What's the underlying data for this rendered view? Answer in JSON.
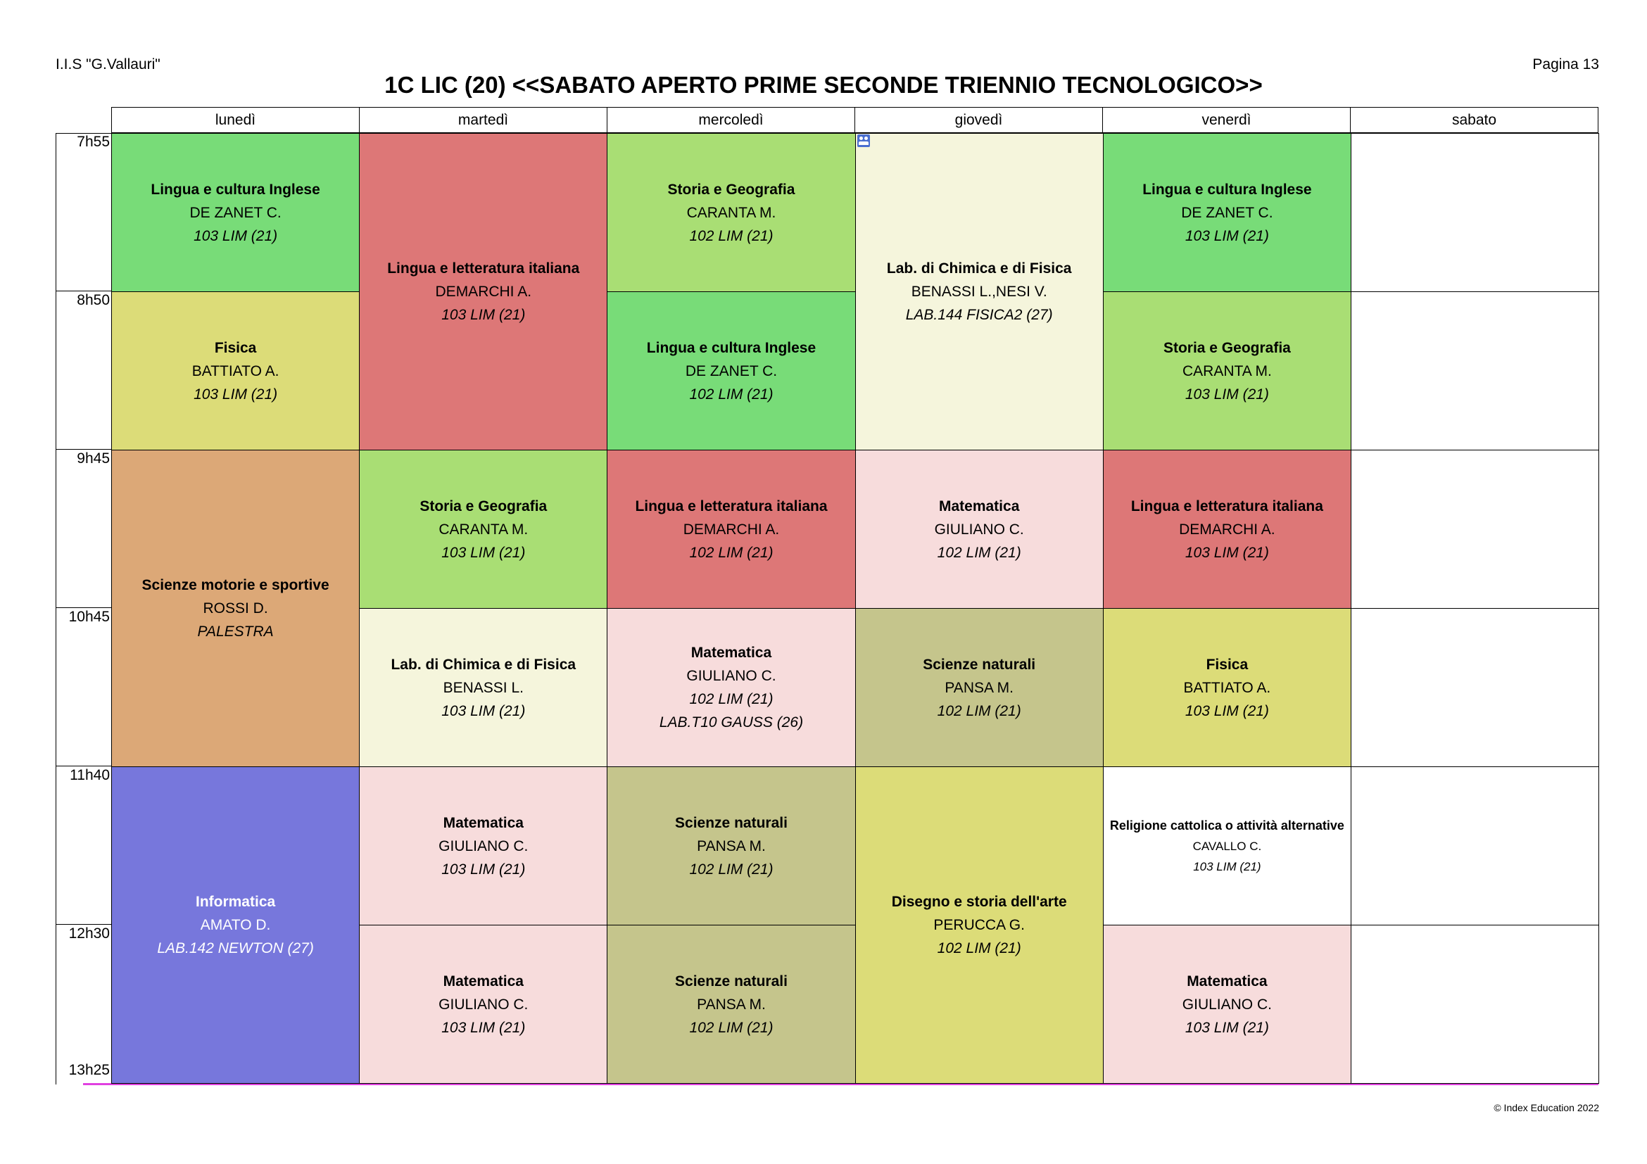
{
  "header": {
    "school": "I.I.S \"G.Vallauri\"",
    "page": "Pagina 13",
    "title": "1C LIC (20) <<SABATO APERTO PRIME SECONDE TRIENNIO TECNOLOGICO>>"
  },
  "days": [
    "lunedì",
    "martedì",
    "mercoledì",
    "giovedì",
    "venerdì",
    "sabato"
  ],
  "times": [
    "7h55",
    "8h50",
    "9h45",
    "10h45",
    "11h40",
    "12h30",
    "13h25"
  ],
  "colors": {
    "inglese": "#78dc78",
    "storia": "#a9de74",
    "italiano": "#dd7777",
    "fisica": "#dcdc78",
    "chimica_lab": "#f5f5dc",
    "matematica": "#f7dcdc",
    "scienze": "#c5c58c",
    "motorie": "#dca877",
    "informatica": "#7777dc",
    "disegno": "#dcdc78",
    "religione": "#ffffff",
    "highlight_line": "#e040e0"
  },
  "lessons": [
    {
      "day": 0,
      "start": 0,
      "end": 1,
      "subject": "Lingua e cultura Inglese",
      "teacher": "DE ZANET C.",
      "rooms": [
        "103 LIM (21)"
      ],
      "color": "inglese"
    },
    {
      "day": 0,
      "start": 1,
      "end": 2,
      "subject": "Fisica",
      "teacher": "BATTIATO A.",
      "rooms": [
        "103 LIM (21)"
      ],
      "color": "fisica"
    },
    {
      "day": 0,
      "start": 2,
      "end": 4,
      "subject": "Scienze motorie e sportive",
      "teacher": "ROSSI D.",
      "rooms": [
        "PALESTRA"
      ],
      "color": "motorie"
    },
    {
      "day": 0,
      "start": 4,
      "end": 6,
      "subject": "Informatica",
      "teacher": "AMATO D.",
      "rooms": [
        "LAB.142 NEWTON (27)"
      ],
      "color": "informatica",
      "white": true
    },
    {
      "day": 1,
      "start": 0,
      "end": 2,
      "subject": "Lingua e letteratura italiana",
      "teacher": "DEMARCHI A.",
      "rooms": [
        "103 LIM (21)"
      ],
      "color": "italiano"
    },
    {
      "day": 1,
      "start": 2,
      "end": 3,
      "subject": "Storia e Geografia",
      "teacher": "CARANTA M.",
      "rooms": [
        "103 LIM (21)"
      ],
      "color": "storia"
    },
    {
      "day": 1,
      "start": 3,
      "end": 4,
      "subject": "Lab. di Chimica e di Fisica",
      "teacher": "BENASSI L.",
      "rooms": [
        "103 LIM (21)"
      ],
      "color": "chimica_lab"
    },
    {
      "day": 1,
      "start": 4,
      "end": 5,
      "subject": "Matematica",
      "teacher": "GIULIANO C.",
      "rooms": [
        "103 LIM (21)"
      ],
      "color": "matematica"
    },
    {
      "day": 1,
      "start": 5,
      "end": 6,
      "subject": "Matematica",
      "teacher": "GIULIANO C.",
      "rooms": [
        "103 LIM (21)"
      ],
      "color": "matematica"
    },
    {
      "day": 2,
      "start": 0,
      "end": 1,
      "subject": "Storia e Geografia",
      "teacher": "CARANTA M.",
      "rooms": [
        "102 LIM (21)"
      ],
      "color": "storia"
    },
    {
      "day": 2,
      "start": 1,
      "end": 2,
      "subject": "Lingua e cultura Inglese",
      "teacher": "DE ZANET C.",
      "rooms": [
        "102 LIM (21)"
      ],
      "color": "inglese"
    },
    {
      "day": 2,
      "start": 2,
      "end": 3,
      "subject": "Lingua e letteratura italiana",
      "teacher": "DEMARCHI A.",
      "rooms": [
        "102 LIM (21)"
      ],
      "color": "italiano"
    },
    {
      "day": 2,
      "start": 3,
      "end": 4,
      "subject": "Matematica",
      "teacher": "GIULIANO C.",
      "rooms": [
        "102 LIM (21)",
        "LAB.T10 GAUSS (26)"
      ],
      "color": "matematica"
    },
    {
      "day": 2,
      "start": 4,
      "end": 5,
      "subject": "Scienze naturali",
      "teacher": "PANSA M.",
      "rooms": [
        "102 LIM (21)"
      ],
      "color": "scienze"
    },
    {
      "day": 2,
      "start": 5,
      "end": 6,
      "subject": "Scienze naturali",
      "teacher": "PANSA M.",
      "rooms": [
        "102 LIM (21)"
      ],
      "color": "scienze"
    },
    {
      "day": 3,
      "start": 0,
      "end": 2,
      "subject": "Lab. di Chimica e di Fisica",
      "teacher": "BENASSI L.,NESI V.",
      "rooms": [
        "LAB.144 FISICA2 (27)"
      ],
      "color": "chimica_lab",
      "group_icon": "group-icon"
    },
    {
      "day": 3,
      "start": 2,
      "end": 3,
      "subject": "Matematica",
      "teacher": "GIULIANO C.",
      "rooms": [
        "102 LIM (21)"
      ],
      "color": "matematica"
    },
    {
      "day": 3,
      "start": 3,
      "end": 4,
      "subject": "Scienze naturali",
      "teacher": "PANSA M.",
      "rooms": [
        "102 LIM (21)"
      ],
      "color": "scienze"
    },
    {
      "day": 3,
      "start": 4,
      "end": 6,
      "subject": "Disegno e storia dell'arte",
      "teacher": "PERUCCA G.",
      "rooms": [
        "102 LIM (21)"
      ],
      "color": "disegno"
    },
    {
      "day": 4,
      "start": 0,
      "end": 1,
      "subject": "Lingua e cultura Inglese",
      "teacher": "DE ZANET C.",
      "rooms": [
        "103 LIM (21)"
      ],
      "color": "inglese"
    },
    {
      "day": 4,
      "start": 1,
      "end": 2,
      "subject": "Storia e Geografia",
      "teacher": "CARANTA M.",
      "rooms": [
        "103 LIM (21)"
      ],
      "color": "storia"
    },
    {
      "day": 4,
      "start": 2,
      "end": 3,
      "subject": "Lingua e letteratura italiana",
      "teacher": "DEMARCHI A.",
      "rooms": [
        "103 LIM (21)"
      ],
      "color": "italiano"
    },
    {
      "day": 4,
      "start": 3,
      "end": 4,
      "subject": "Fisica",
      "teacher": "BATTIATO A.",
      "rooms": [
        "103 LIM (21)"
      ],
      "color": "fisica"
    },
    {
      "day": 4,
      "start": 4,
      "end": 5,
      "subject": "Religione cattolica o attività alternative",
      "teacher": "CAVALLO C.",
      "rooms": [
        "103 LIM (21)"
      ],
      "color": "religione",
      "small": true
    },
    {
      "day": 4,
      "start": 5,
      "end": 6,
      "subject": "Matematica",
      "teacher": "GIULIANO C.",
      "rooms": [
        "103 LIM (21)"
      ],
      "color": "matematica"
    }
  ],
  "footer": {
    "copyright": "© Index Education 2022"
  }
}
